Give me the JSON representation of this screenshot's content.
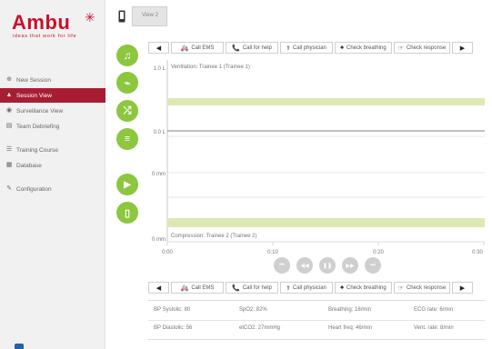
{
  "brand": {
    "name": "Ambu",
    "tagline": "ideas that work for life",
    "color": "#c8102e"
  },
  "sidebar": {
    "items": [
      {
        "label": "New Session",
        "icon": "plus-circle-icon"
      },
      {
        "label": "Session View",
        "icon": "person-icon",
        "active": true
      },
      {
        "label": "Surveillance View",
        "icon": "eye-icon"
      },
      {
        "label": "Team Debriefing",
        "icon": "document-icon"
      },
      {
        "label": "Training Course",
        "icon": "list-icon"
      },
      {
        "label": "Database",
        "icon": "database-icon"
      },
      {
        "label": "Configuration",
        "icon": "wrench-icon"
      }
    ]
  },
  "top": {
    "view_tab": "View 2"
  },
  "toolbar": {
    "actions": [
      {
        "label": "Call EMS",
        "icon": "ambulance-icon"
      },
      {
        "label": "Call for help",
        "icon": "phone-icon"
      },
      {
        "label": "Call physician",
        "icon": "physician-icon"
      },
      {
        "label": "Check breathing",
        "icon": "lungs-icon"
      },
      {
        "label": "Check response",
        "icon": "hand-icon"
      }
    ]
  },
  "chart_data": {
    "type": "line",
    "x_ticks": [
      "0:00",
      "0:10",
      "0:20",
      "0:30"
    ],
    "y_labels": {
      "ventilation_top": "1.0 L",
      "ventilation_bottom": "0.0 L",
      "compression_top": "0 mm",
      "compression_bottom": "0 mm"
    },
    "ventilation_title": "Ventilation: Trainee 1 (Trainee 1)",
    "compression_title": "Compression: Trainee 2 (Trainee 2)",
    "target_band_color": "#dde9b3"
  },
  "vitals": {
    "bp_systolic": "BP Systolic: 80",
    "spo2": "SpO2: 82%",
    "breathing": "Breathing: 18/min",
    "ecg": "ECG rate: 6/min",
    "bp_diastolic": "BP Diastolic: 56",
    "etco2": "etCO2: 27mmHg",
    "heart_freq": "Heart freq: 46/min",
    "vent_rate": "Vent. rate: 8/min"
  }
}
